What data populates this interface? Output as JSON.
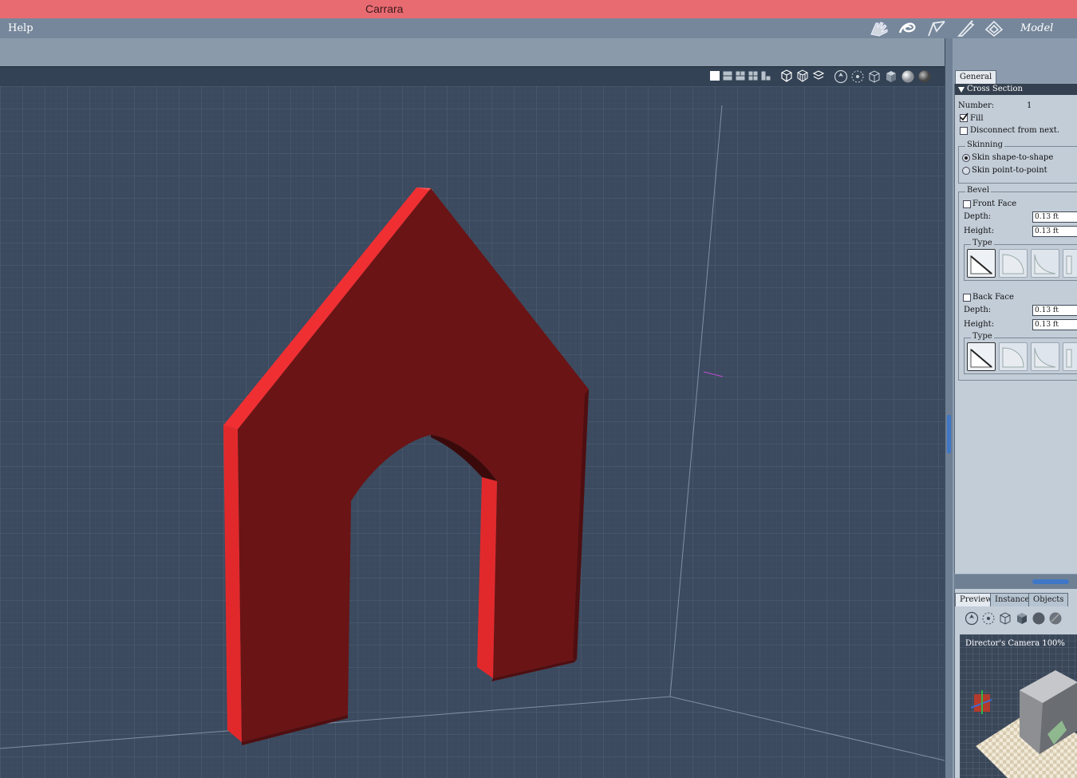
{
  "app": {
    "title": "Carrara",
    "room": "Model"
  },
  "menu": {
    "help": "Help"
  },
  "room_tools": [
    "hand-room-icon",
    "shape-room-icon",
    "assemble-room-icon",
    "render-room-icon",
    "storyboard-room-icon"
  ],
  "viewbar": {
    "layout_icons": [
      "single-view-icon",
      "two-horizontal-view-icon",
      "three-view-icon",
      "four-view-icon",
      "custom-layout-icon"
    ],
    "display_icons": [
      "bounding-box-icon",
      "wireframe-icon",
      "hidden-line-icon"
    ],
    "camera_icons": [
      "dolly-icon",
      "move-camera-icon",
      "cube-icon",
      "shaded-cube-icon",
      "sphere-render-icon",
      "lit-sphere-icon"
    ]
  },
  "colors": {
    "object_red": "#6a1415",
    "highlight_red": "#e1292c",
    "grid_bg": "#3b4a5e",
    "accent": "#3f77c7"
  },
  "panel": {
    "tab_general": "General",
    "section": "Cross Section",
    "number_label": "Number:",
    "number_value": "1",
    "fill_label": "Fill",
    "fill_checked": true,
    "disconnect_label": "Disconnect from next.",
    "disconnect_checked": false,
    "skinning": {
      "title": "Skinning",
      "opt1": "Skin shape-to-shape",
      "opt2": "Skin point-to-point",
      "selected": "Skin shape-to-shape"
    },
    "bevel": {
      "title": "Bevel",
      "front_label": "Front Face",
      "front_checked": false,
      "front_depth_label": "Depth:",
      "front_depth": "0.13 ft",
      "front_height_label": "Height:",
      "front_height": "0.13 ft",
      "front_type_label": "Type",
      "back_label": "Back Face",
      "back_checked": false,
      "back_depth_label": "Depth:",
      "back_depth": "0.13 ft",
      "back_height_label": "Height:",
      "back_height": "0.13 ft",
      "back_type_label": "Type"
    }
  },
  "bottom": {
    "tabs": [
      "Preview",
      "Instances",
      "Objects"
    ],
    "active_tab": "Preview",
    "camera_caption": "Director's Camera 100%"
  }
}
